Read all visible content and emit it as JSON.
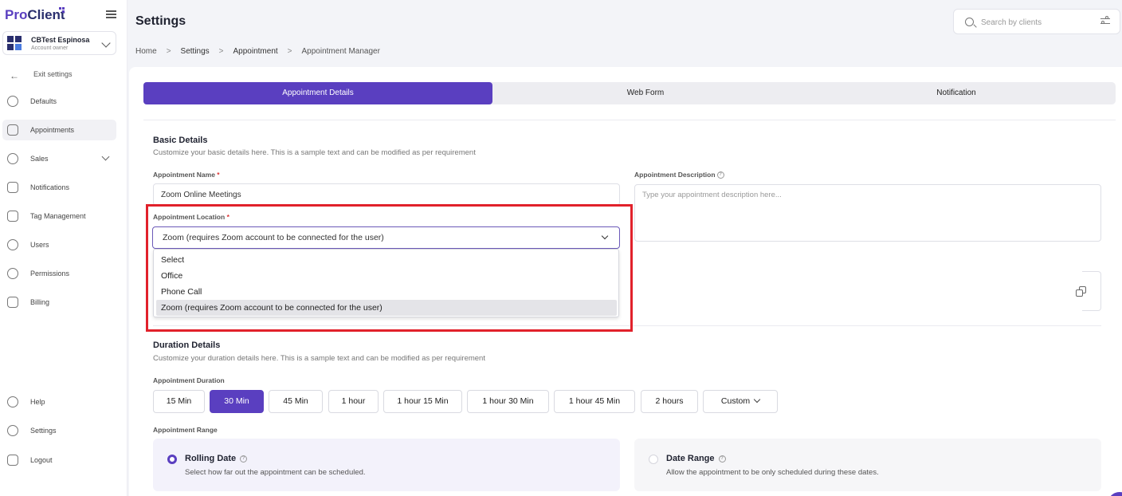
{
  "brand": {
    "logo_pro": "Pro",
    "logo_client": "Client"
  },
  "account": {
    "name": "CBTest Espinosa",
    "role": "Account owner"
  },
  "sidebar": {
    "exit_label": "Exit settings",
    "items": [
      {
        "label": "Defaults"
      },
      {
        "label": "Appointments"
      },
      {
        "label": "Sales"
      },
      {
        "label": "Notifications"
      },
      {
        "label": "Tag Management"
      },
      {
        "label": "Users"
      },
      {
        "label": "Permissions"
      },
      {
        "label": "Billing"
      }
    ],
    "bottom_items": [
      {
        "label": "Help"
      },
      {
        "label": "Settings"
      },
      {
        "label": "Logout"
      }
    ]
  },
  "header": {
    "title": "Settings",
    "search_placeholder": "Search by clients"
  },
  "breadcrumb": [
    "Home",
    "Settings",
    "Appointment",
    "Appointment Manager"
  ],
  "tabs": [
    "Appointment Details",
    "Web Form",
    "Notification"
  ],
  "basic": {
    "title": "Basic Details",
    "subtitle": "Customize your basic details here. This is a sample text and can be modified as per requirement",
    "name_label": "Appointment Name",
    "name_value": "Zoom Online Meetings",
    "desc_label": "Appointment Description",
    "desc_placeholder": "Type your appointment description here...",
    "location_label": "Appointment Location",
    "location_value": "Zoom (requires Zoom account to be connected for the user)",
    "location_options": [
      "Select",
      "Office",
      "Phone Call",
      "Zoom (requires Zoom account to be connected for the user)"
    ]
  },
  "duration": {
    "title": "Duration Details",
    "subtitle": "Customize your duration details here. This is a sample text and can be modified as per requirement",
    "label": "Appointment Duration",
    "options": [
      "15 Min",
      "30 Min",
      "45 Min",
      "1 hour",
      "1 hour 15 Min",
      "1 hour 30 Min",
      "1 hour 45 Min",
      "2 hours",
      "Custom"
    ],
    "selected": "30 Min"
  },
  "range": {
    "label": "Appointment Range",
    "rolling_title": "Rolling Date",
    "rolling_desc": "Select how far out the appointment can be scheduled.",
    "date_title": "Date Range",
    "date_desc": "Allow the appointment to be only scheduled during these dates."
  },
  "colors": {
    "accent": "#5a3fc0",
    "highlight": "#e1212b"
  }
}
